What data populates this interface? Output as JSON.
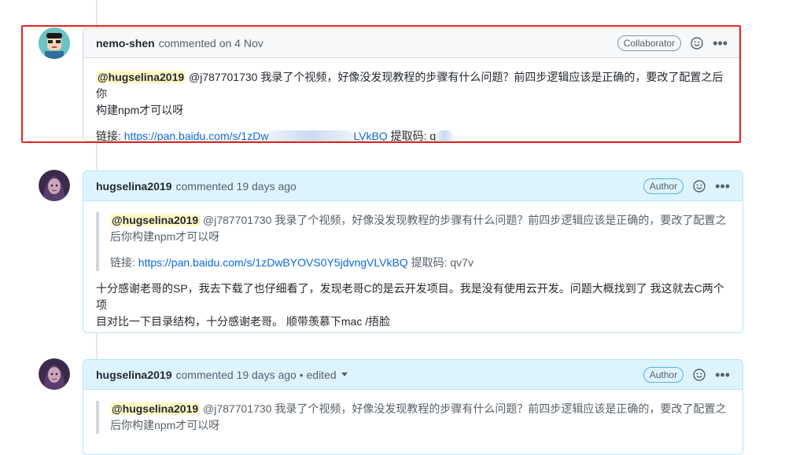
{
  "comments": [
    {
      "login": "nemo-shen",
      "meta": "commented on 4 Nov",
      "badge": "Collaborator",
      "line1_mention": "@hugselina2019",
      "line1_rest": " @j787701730 我录了个视频，好像没发现教程的步骤有什么问题？前四步逻辑应该是正确的，要改了配置之后你",
      "line2": "构建npm才可以呀",
      "link_label": "链接: ",
      "link_start": "https://pan.baidu.com/s/1zDw",
      "link_end": "LVkBQ",
      "code_label": " 提取码: q"
    },
    {
      "login": "hugselina2019",
      "meta": "commented 19 days ago",
      "badge": "Author",
      "quote_mention": "@hugselina2019",
      "quote_rest": " @j787701730 我录了个视频，好像没发现教程的步骤有什么问题？前四步逻辑应该是正确的，要改了配置之",
      "quote_line2": "后你构建npm才可以呀",
      "link_label": "链接: ",
      "link": "https://pan.baidu.com/s/1zDwBYOVS0Y5jdvngVLVkBQ",
      "code": " 提取码: qv7v",
      "reply_line1": "十分感谢老哥的SP，我去下载了也仔细看了，发现老哥C的是云开发项目。我是没有使用云开发。问题大概找到了 我这就去C两个项",
      "reply_line2": "目对比一下目录结构，十分感谢老哥。 顺带羡慕下mac /捂脸"
    },
    {
      "login": "hugselina2019",
      "meta": "commented 19 days ago • edited",
      "badge": "Author",
      "quote_mention": "@hugselina2019",
      "quote_rest": " @j787701730 我录了个视频，好像没发现教程的步骤有什么问题？前四步逻辑应该是正确的，要改了配置之",
      "quote_line2": "后你构建npm才可以呀"
    }
  ],
  "colors": {
    "highlight": "#e5231f",
    "link": "#0969da",
    "author_header": "#ddf4ff"
  },
  "icons": [
    "smiley-icon",
    "kebab-menu-icon",
    "caret-down-icon"
  ]
}
